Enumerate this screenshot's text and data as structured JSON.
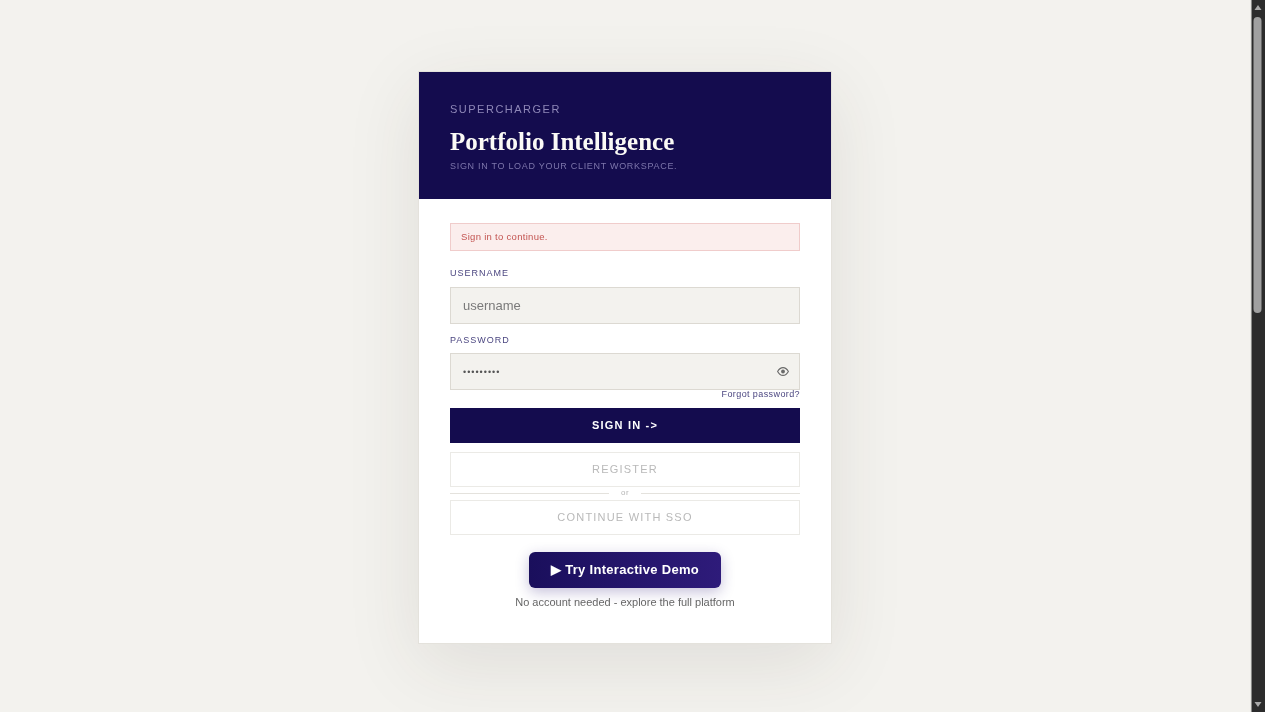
{
  "header": {
    "brand": "SUPERCHARGER",
    "title": "Portfolio Intelligence",
    "subtitle": "SIGN IN TO LOAD YOUR CLIENT WORKSPACE."
  },
  "alert": {
    "text": "Sign in to continue."
  },
  "fields": [
    {
      "kind": "text",
      "label": "USERNAME",
      "placeholder": "username"
    },
    {
      "kind": "password",
      "label": "PASSWORD",
      "value": "•••••••••"
    }
  ],
  "forgot_link": "Forgot password?",
  "actions": [
    {
      "kind": "primary",
      "label": "SIGN IN ->"
    },
    {
      "kind": "secondary",
      "label": "REGISTER"
    },
    {
      "kind": "divider",
      "label": "or"
    },
    {
      "kind": "secondary",
      "label": "CONTINUE WITH SSO"
    }
  ],
  "demo": {
    "button": "▶ Try Interactive Demo",
    "caption": "No account needed - explore the full platform"
  }
}
